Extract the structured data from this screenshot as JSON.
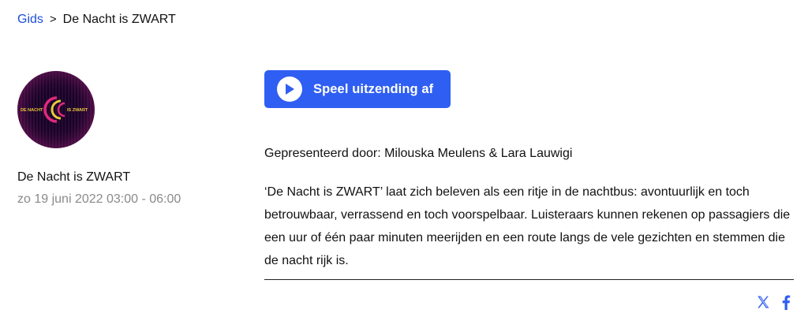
{
  "breadcrumb": {
    "root_label": "Gids",
    "separator": ">",
    "current_label": "De Nacht is ZWART"
  },
  "logo": {
    "text_left": "DE NACHT",
    "text_right": "IS ZWART",
    "colors": {
      "background": "#1a0626",
      "accent_pink": "#e0287d",
      "accent_yellow": "#e8c93a"
    }
  },
  "show": {
    "title": "De Nacht is ZWART",
    "datetime": "zo 19 juni 2022 03:00 - 06:00"
  },
  "player": {
    "play_label": "Speel uitzending af",
    "icon": "play-icon",
    "color": "#2f5ef2"
  },
  "presenters": "Gepresenteerd door: Milouska Meulens & Lara Lauwigi",
  "description": "‘De Nacht is ZWART’ laat zich beleven als een ritje in de nachtbus: avontuurlijk en toch betrouwbaar, verrassend en toch voorspelbaar. Luisteraars kunnen rekenen op passagiers die een uur of één paar minuten meerijden en een route langs de vele gezichten en stemmen die de nacht rijk is.",
  "share": {
    "icons": [
      "x-twitter-icon",
      "facebook-icon"
    ],
    "color": "#2f5ef2"
  },
  "colors": {
    "link": "#1d4ed8",
    "muted": "#8a8a8a"
  }
}
